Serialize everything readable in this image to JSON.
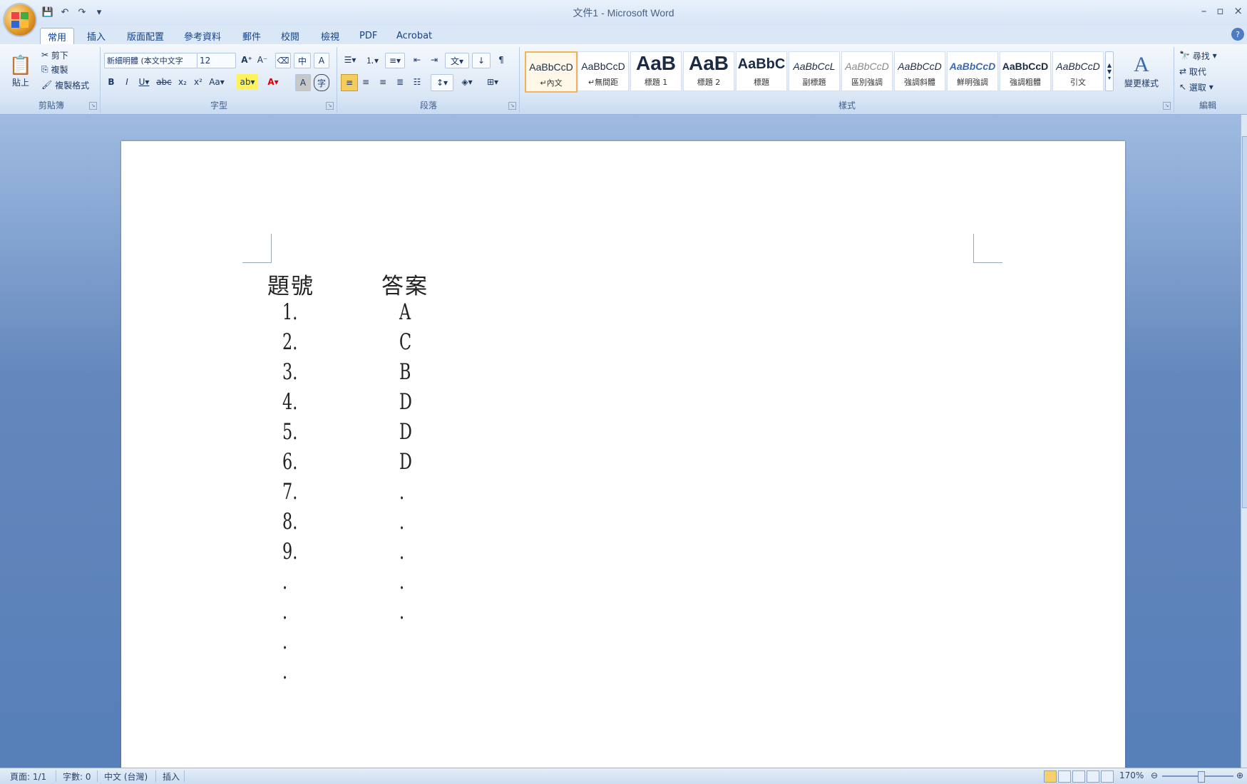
{
  "window": {
    "title": "文件1 - Microsoft Word",
    "controls": [
      "–",
      "▫",
      "×"
    ]
  },
  "qat": [
    "💾",
    "↶",
    "↷",
    "▾"
  ],
  "tabs": [
    "常用",
    "插入",
    "版面配置",
    "參考資料",
    "郵件",
    "校閱",
    "檢視",
    "PDF",
    "Acrobat"
  ],
  "ribbon": {
    "clipboard": {
      "label": "剪貼簿",
      "paste": "貼上",
      "cut": "剪下",
      "copy": "複製",
      "format_painter": "複製格式"
    },
    "font": {
      "label": "字型",
      "font_name": "新細明體 (本文中文字",
      "font_size": "12"
    },
    "paragraph": {
      "label": "段落"
    },
    "styles": {
      "label": "樣式",
      "change_styles": "變更樣式",
      "items": [
        {
          "sample": "AaBbCcD",
          "name": "↵內文"
        },
        {
          "sample": "AaBbCcD",
          "name": "↵無間距"
        },
        {
          "sample": "AaB",
          "name": "標題 1"
        },
        {
          "sample": "AaB",
          "name": "標題 2"
        },
        {
          "sample": "AaBbC",
          "name": "標題"
        },
        {
          "sample": "AaBbCcL",
          "name": "副標題"
        },
        {
          "sample": "AaBbCcD",
          "name": "區別強調"
        },
        {
          "sample": "AaBbCcD",
          "name": "強調斜體"
        },
        {
          "sample": "AaBbCcD",
          "name": "鮮明強調"
        },
        {
          "sample": "AaBbCcD",
          "name": "強調粗體"
        },
        {
          "sample": "AaBbCcD",
          "name": "引文"
        }
      ]
    },
    "editing": {
      "label": "編輯",
      "find": "尋找",
      "replace": "取代",
      "select": "選取"
    }
  },
  "document": {
    "header_num": "題號",
    "header_ans": "答案",
    "rows": [
      {
        "num": "1.",
        "ans": "A"
      },
      {
        "num": "2.",
        "ans": "C"
      },
      {
        "num": "3.",
        "ans": "B"
      },
      {
        "num": "4.",
        "ans": "D"
      },
      {
        "num": "5.",
        "ans": "D"
      },
      {
        "num": "6.",
        "ans": "D"
      },
      {
        "num": "7.",
        "ans": "."
      },
      {
        "num": "8.",
        "ans": "."
      },
      {
        "num": "9.",
        "ans": "."
      },
      {
        "num": ".",
        "ans": "."
      },
      {
        "num": ".",
        "ans": "."
      },
      {
        "num": ".",
        "ans": ""
      },
      {
        "num": ".",
        "ans": ""
      }
    ]
  },
  "status": {
    "page": "頁面: 1/1",
    "words": "字數: 0",
    "language": "中文 (台灣)",
    "mode": "插入",
    "zoom": "170%"
  },
  "colors": {
    "accent": "#15428b",
    "ribbon_bg": "#dce8f6",
    "workspace": "#6b8fc4"
  }
}
